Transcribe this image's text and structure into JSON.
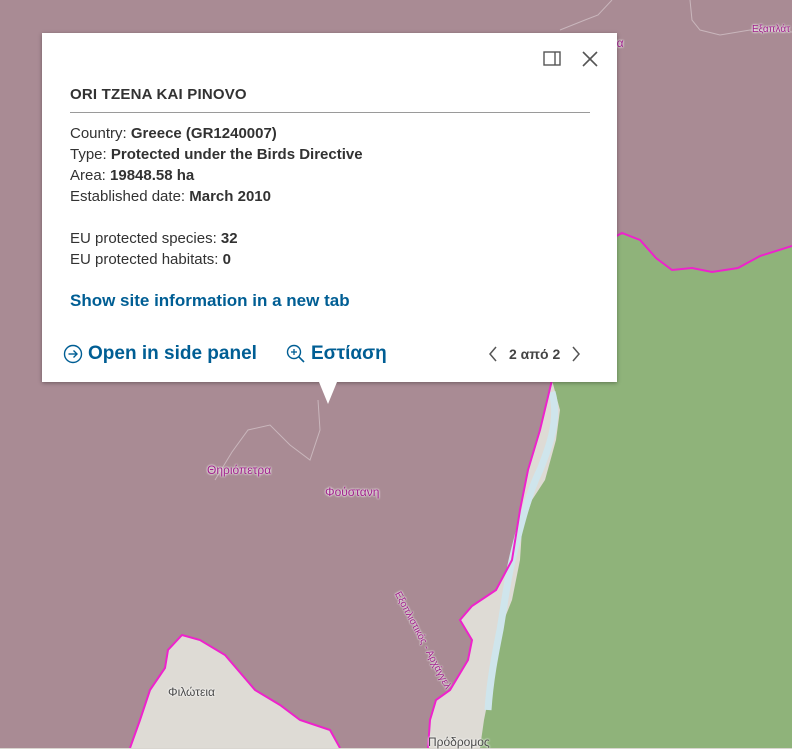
{
  "map": {
    "colors": {
      "protected_area": "#a98b94",
      "green_area": "#8fb37a",
      "boundary": "#ee22cc",
      "outside": "#dedbd5"
    },
    "place_labels": [
      "Θηριόπετρα",
      "Φούστανη",
      "Φιλώτεια",
      "Πρόδρομος",
      "Εξοπλιστικός - Αρχάγγελ",
      "Εξαπλάτ",
      "ια"
    ]
  },
  "popup": {
    "title": "ORI TZENA KAI PINOVO",
    "country_label": "Country:",
    "country_value": "Greece (GR1240007)",
    "type_label": "Type:",
    "type_value": "Protected under the Birds Directive",
    "area_label": "Area:",
    "area_value": "19848.58 ha",
    "established_label": "Established date:",
    "established_value": "March 2010",
    "species_label": "EU protected species:",
    "species_value": "32",
    "habitats_label": "EU protected habitats:",
    "habitats_value": "0",
    "site_link": "Show site information in a new tab",
    "open_side_panel": "Open in side panel",
    "zoom_to": "Εστίαση",
    "pager": "2 από 2",
    "icons": {
      "dock": "dock-icon",
      "close": "close-icon",
      "open": "arrow-circle-icon",
      "zoom": "zoom-in-icon",
      "prev": "chevron-left-icon",
      "next": "chevron-right-icon"
    }
  }
}
